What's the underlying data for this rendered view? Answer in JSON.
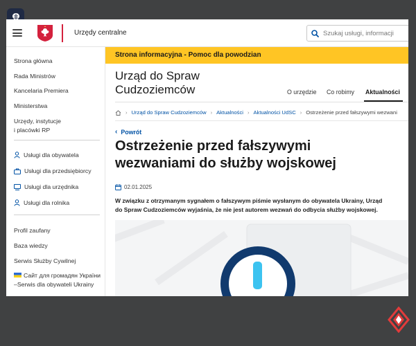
{
  "header": {
    "office_link": "Urzędy centralne",
    "search_placeholder": "Szukaj usługi, informacji"
  },
  "sidebar": {
    "primary": [
      "Strona główna",
      "Rada Ministrów",
      "Kancelaria Premiera",
      "Ministerstwa",
      "Urzędy, instytucje",
      "i placówki RP"
    ],
    "services": [
      "Usługi dla obywatela",
      "Usługi dla przedsiębiorcy",
      "Usługi dla urzędnika",
      "Usługi dla rolnika"
    ],
    "secondary": [
      "Profil zaufany",
      "Baza wiedzy",
      "Serwis Służby Cywilnej",
      "Сайт для громадян України",
      "–Serwis dla obywateli Ukrainy"
    ]
  },
  "banner": "Strona informacyjna - Pomoc dla powodzian",
  "agency": {
    "title_line1": "Urząd do Spraw",
    "title_line2": "Cudzoziemców",
    "nav": [
      "O urzędzie",
      "Co robimy",
      "Aktualności"
    ]
  },
  "breadcrumb": [
    "Urząd do Spraw Cudzoziemców",
    "Aktualności",
    "Aktualności UdSC",
    "Ostrzeżenie przed fałszywymi wezwani"
  ],
  "article": {
    "back": "Powrót",
    "title_line1": "Ostrzeżenie przed fałszywymi",
    "title_line2": "wezwaniami do służby wojskowej",
    "date": "02.01.2025",
    "lead_line1": "W związku z otrzymanym sygnałem o fałszywym piśmie wysłanym do obywatela Ukrainy, Urząd",
    "lead_line2": "do Spraw Cudzoziemców wyjaśnia, że nie jest autorem wezwań do odbycia służby wojskowej."
  },
  "colors": {
    "banner": "#ffc524",
    "link": "#0052a5",
    "emblem_red": "#d4213d",
    "warning_ring": "#113a6e",
    "warning_mark": "#3cc3f0"
  }
}
